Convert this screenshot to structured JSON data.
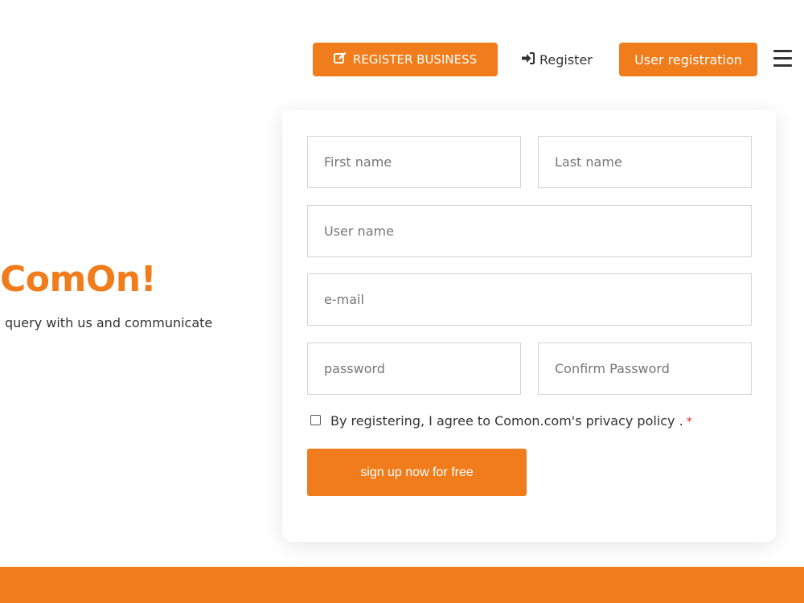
{
  "header": {
    "register_business_label": "REGISTER BUSINESS",
    "register_label": "Register",
    "user_registration_label": "User registration"
  },
  "hero": {
    "title": "ComOn!",
    "subtitle": "query with us and communicate"
  },
  "form": {
    "first_name_placeholder": "First name",
    "last_name_placeholder": "Last name",
    "user_name_placeholder": "User name",
    "email_placeholder": "e-mail",
    "password_placeholder": "password",
    "confirm_password_placeholder": "Confirm Password",
    "agree_text": "By registering, I agree to Comon.com's privacy policy .",
    "required_marker": "*",
    "agree_checked": false,
    "submit_label": "sign up now for free"
  },
  "colors": {
    "accent": "#f07c1b",
    "required": "#e02424"
  }
}
